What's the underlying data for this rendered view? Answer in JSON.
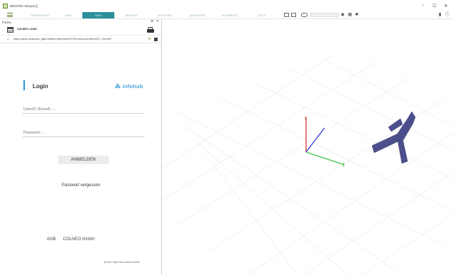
{
  "window": {
    "title": "DEVSTE mid.pos []",
    "min": "−",
    "max": "☐",
    "close": "✕"
  },
  "toolbar": {
    "tabs": [
      "TRANSACTION",
      "VIEW",
      "DATA",
      "BUILDING",
      "ACTIVITIES",
      "QUANTITIES",
      "DOCUMENTS",
      "TOOLS"
    ],
    "active_tab": "DATA",
    "icons": [
      "grid-icon",
      "monitor-icon",
      "view-icon",
      "eye-icon",
      "layers-icon",
      "settings-icon",
      "panel-icon",
      "info-icon"
    ]
  },
  "panel": {
    "title": "Forms",
    "pin": "⊕",
    "close": "✕",
    "form_name": "COLNEO LOGIN",
    "url": "https://colneo.services/ix_login?redirect=https%3A%2F%2Fcolneo.services%2FC_Dem%2F",
    "plus": "+"
  },
  "login": {
    "title": "Login",
    "brand": "infohub",
    "brand_icon": "⁂",
    "userid_label": "UserID (Email) ...",
    "password_label": "Passwort ...",
    "submit": "ANMELDEN",
    "forgot": "Passwort vergessen",
    "agb": "AGB",
    "company": "COLNEO GmbH",
    "service": "Service: https://dev.colneo.info/iam"
  },
  "colors": {
    "accent": "#2a8f9a",
    "brand_blue": "#4aa3df",
    "axis_x": "#41c24a",
    "axis_y": "#d92020",
    "axis_z": "#2b2fd0",
    "model": "#4b4f8c"
  }
}
